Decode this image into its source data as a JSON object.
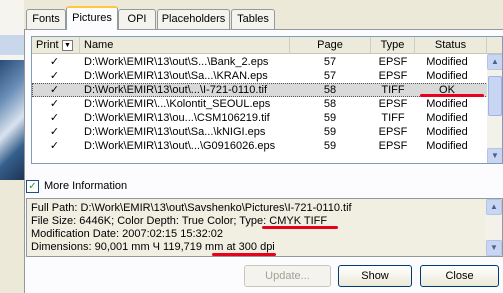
{
  "tabs": [
    {
      "label": "Fonts"
    },
    {
      "label": "Pictures"
    },
    {
      "label": "OPI"
    },
    {
      "label": "Placeholders"
    },
    {
      "label": "Tables"
    }
  ],
  "list": {
    "columns": {
      "print": "Print",
      "name": "Name",
      "page": "Page",
      "type": "Type",
      "status": "Status"
    },
    "rows": [
      {
        "print": "✓",
        "name": "D:\\Work\\EMIR\\13\\out\\S...\\Bank_2.eps",
        "page": "57",
        "type": "EPSF",
        "status": "Modified"
      },
      {
        "print": "✓",
        "name": "D:\\Work\\EMIR\\13\\out\\Sa...\\KRAN.eps",
        "page": "57",
        "type": "EPSF",
        "status": "Modified"
      },
      {
        "print": "✓",
        "name": "D:\\Work\\EMIR\\13\\out\\...\\I-721-0110.tif",
        "page": "58",
        "type": "TIFF",
        "status": "OK"
      },
      {
        "print": "✓",
        "name": "D:\\Work\\EMIR\\...\\Kolontit_SEOUL.eps",
        "page": "58",
        "type": "EPSF",
        "status": "Modified"
      },
      {
        "print": "✓",
        "name": "D:\\Work\\EMIR\\13\\ou...\\CSM106219.tif",
        "page": "59",
        "type": "TIFF",
        "status": "Modified"
      },
      {
        "print": "✓",
        "name": "D:\\Work\\EMIR\\13\\out\\Sa...\\kNIGI.eps",
        "page": "59",
        "type": "EPSF",
        "status": "Modified"
      },
      {
        "print": "✓",
        "name": "D:\\Work\\EMIR\\13\\out\\...\\G0916026.eps",
        "page": "59",
        "type": "EPSF",
        "status": "Modified"
      }
    ]
  },
  "more_info": {
    "label": "More Information",
    "checked": true
  },
  "info": {
    "full_path": "Full Path:  D:\\Work\\EMIR\\13\\out\\Savshenko\\Pictures\\I-721-0110.tif",
    "line2_a": "File Size:  6446K;  Color Depth: True Color;  Type: ",
    "line2_b": "CMYK TIFF",
    "modification": "Modification Date:    2007:02:15 15:32:02",
    "dim_a": "Dimensions: 90,001 mm Ч 119,719 mm ",
    "dim_b": "at 300 dpi"
  },
  "buttons": {
    "update": "Update...",
    "show": "Show",
    "close": "Close"
  },
  "colors": {
    "annotation": "#e8001c",
    "tab_active_accent": "#ffc83c"
  }
}
